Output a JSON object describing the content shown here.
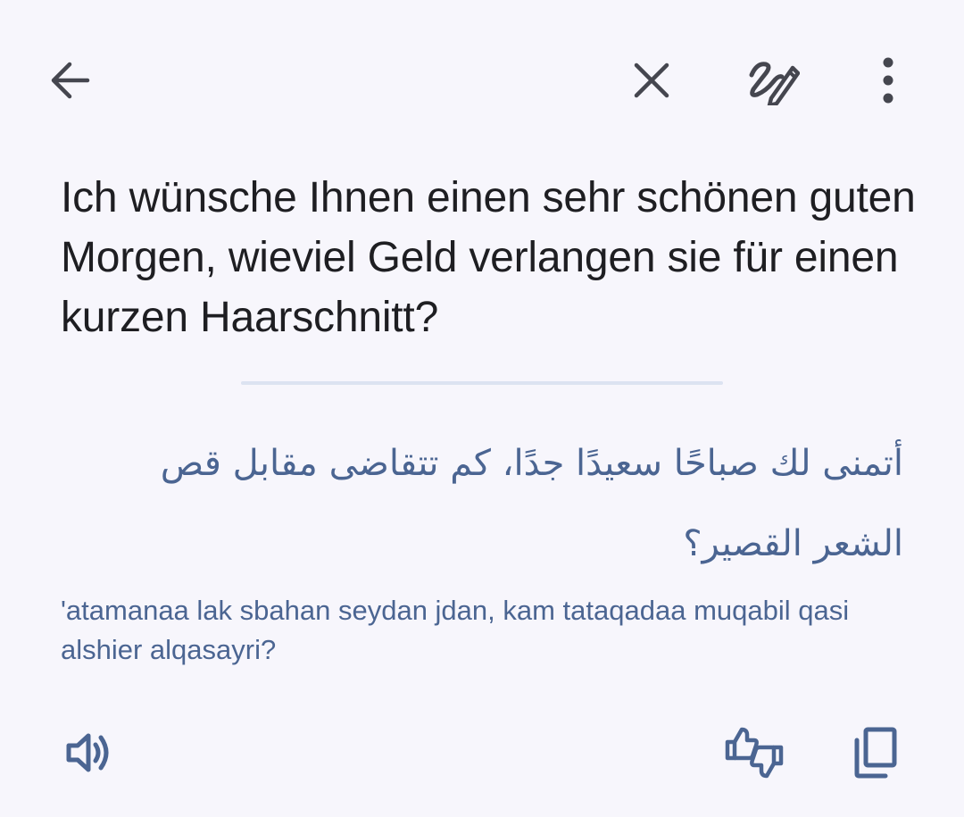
{
  "toolbar": {
    "back_icon": "arrow-back-icon",
    "close_icon": "close-icon",
    "handwrite_icon": "handwriting-icon",
    "more_icon": "more-vert-icon"
  },
  "source": {
    "text": "Ich wünsche Ihnen einen sehr schönen guten Morgen, wieviel Geld verlangen sie für einen kurzen Haarschnitt?"
  },
  "translation": {
    "text": "أتمنى لك صباحًا سعيدًا جدًا، كم تتقاضى مقابل قص الشعر القصير؟",
    "transliteration": "'atamanaa lak sbahan seydan jdan, kam tataqadaa muqabil qasi alshier alqasayri?"
  },
  "actions": {
    "speak_icon": "volume-up-icon",
    "feedback_icon": "thumbs-up-down-icon",
    "copy_icon": "content-copy-icon"
  },
  "colors": {
    "background": "#f7f6fc",
    "source_text": "#1e1e22",
    "accent": "#4b6592",
    "icon": "#45464f",
    "divider": "#dce3f1"
  }
}
